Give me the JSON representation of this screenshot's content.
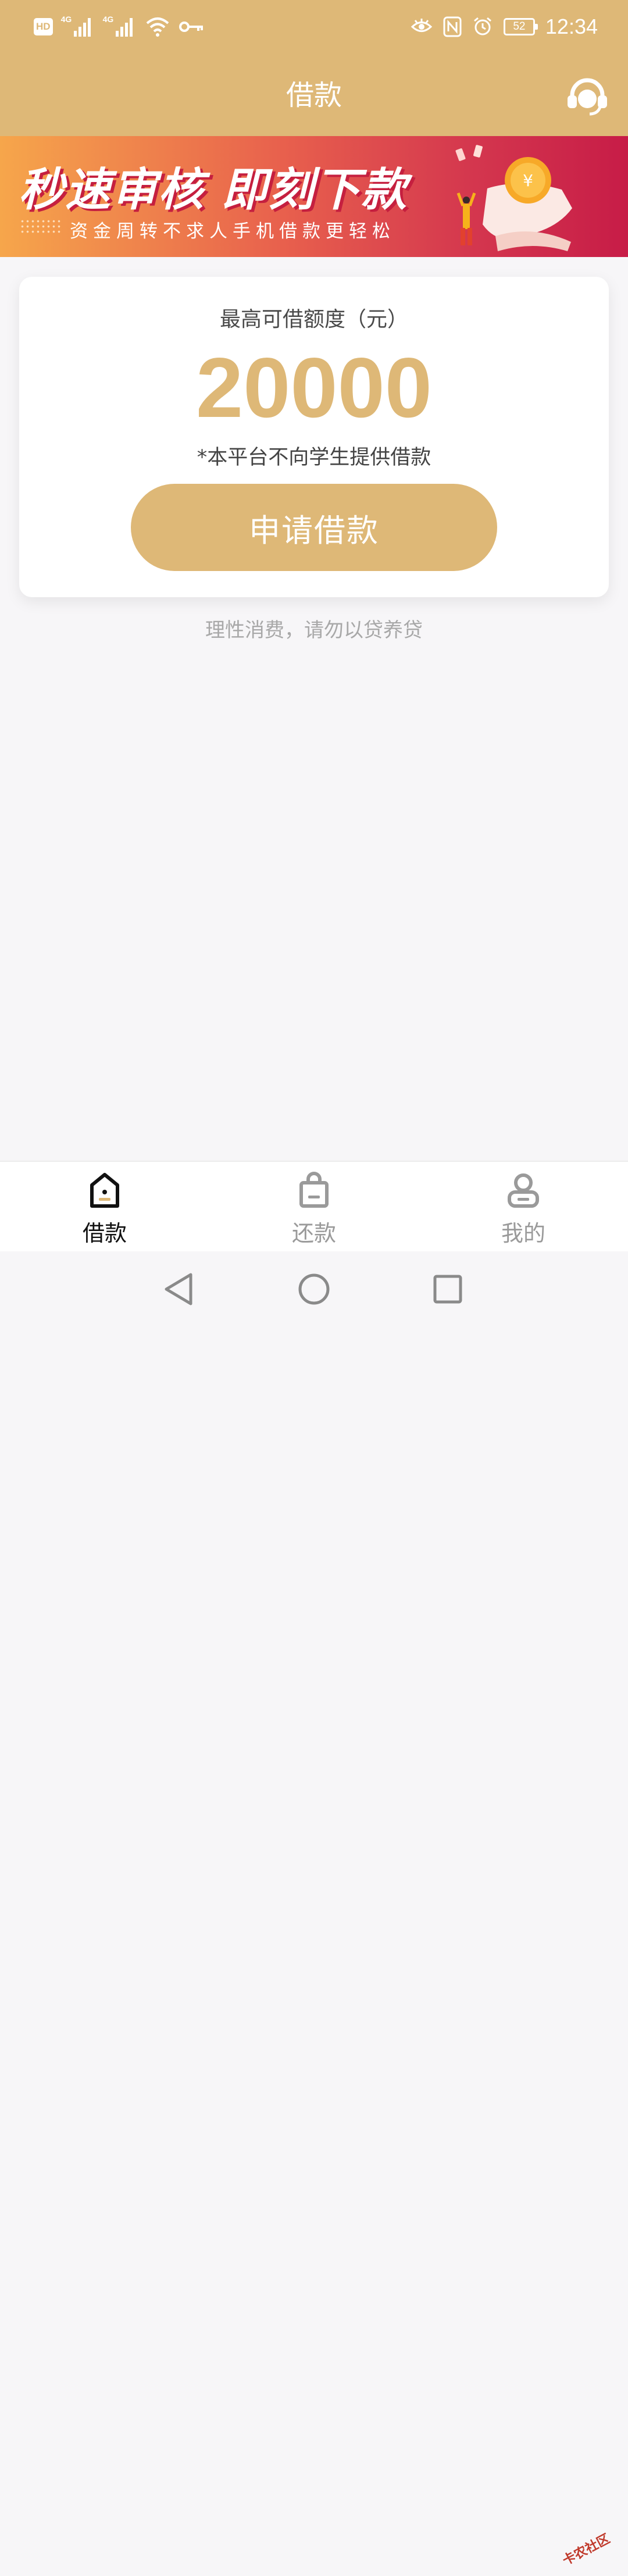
{
  "status_bar": {
    "hd_label": "HD",
    "hd_sub": "1",
    "network_1": "4G",
    "network_2": "4G",
    "nfc_label": "N",
    "battery": "52",
    "time": "12:34"
  },
  "header": {
    "title": "借款",
    "support_icon": "headset-icon"
  },
  "banner": {
    "headline": "秒速审核 即刻下款",
    "subline": "资金周转不求人手机借款更轻松"
  },
  "loan_card": {
    "label": "最高可借额度（元）",
    "amount": "20000",
    "note": "*本平台不向学生提供借款",
    "apply_label": "申请借款"
  },
  "tip": "理性消费，请勿以贷养贷",
  "tabs": [
    {
      "label": "借款",
      "icon": "loan-icon",
      "active": true
    },
    {
      "label": "还款",
      "icon": "repay-icon",
      "active": false
    },
    {
      "label": "我的",
      "icon": "profile-icon",
      "active": false
    }
  ],
  "watermark": "卡农社区",
  "colors": {
    "brand": "#deb877",
    "banner_start": "#f6a64b",
    "banner_end": "#c71c47",
    "background": "#f7f6f8"
  }
}
